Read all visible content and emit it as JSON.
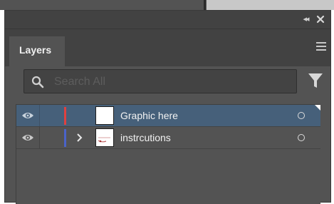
{
  "panel": {
    "tab_label": "Layers",
    "colors": {
      "panel_bg": "#535353",
      "titlebar_bg": "#424242",
      "selected_row": "#46607a"
    }
  },
  "search": {
    "placeholder": "Search All",
    "value": ""
  },
  "layers": [
    {
      "name": "Graphic here",
      "color": "#e0413f",
      "selected": true,
      "expandable": false,
      "visible": true
    },
    {
      "name": "instrcutions",
      "color": "#4a63c9",
      "selected": false,
      "expandable": true,
      "visible": true
    }
  ],
  "icons": [
    "collapse-icon",
    "close-icon",
    "panel-menu-icon",
    "search-icon",
    "filter-icon",
    "eye-icon",
    "chevron-right-icon",
    "target-circle-icon"
  ]
}
